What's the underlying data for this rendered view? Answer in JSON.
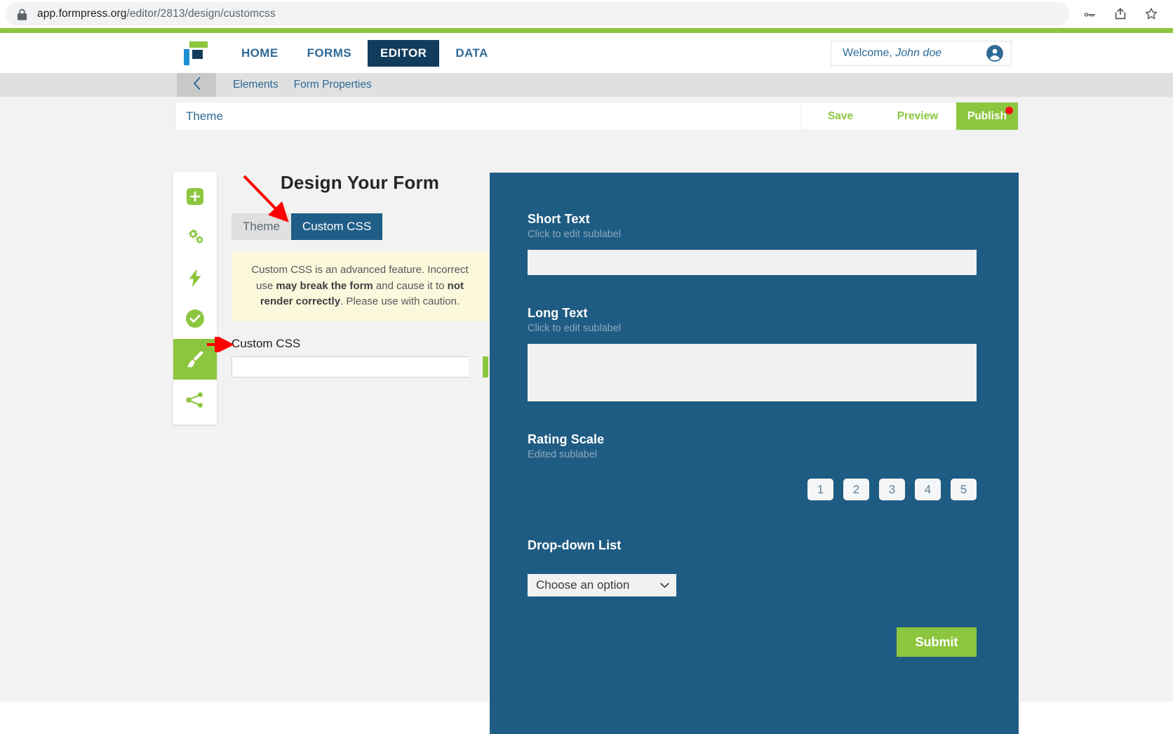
{
  "browser": {
    "url_secure_prefix": "app.formpress.org",
    "url_path": "/editor/2813/design/customcss",
    "lock_icon": "lock-icon",
    "actions": [
      {
        "name": "password-key-icon",
        "label": "key"
      },
      {
        "name": "share-icon",
        "label": "share"
      },
      {
        "name": "bookmark-star-icon",
        "label": "bookmark"
      }
    ]
  },
  "topnav": {
    "logo_name": "formpress-logo",
    "links": [
      {
        "label": "HOME",
        "active": false
      },
      {
        "label": "FORMS",
        "active": false
      },
      {
        "label": "EDITOR",
        "active": true
      },
      {
        "label": "DATA",
        "active": false
      }
    ],
    "welcome_prefix": "Welcome, ",
    "welcome_user": "John doe",
    "avatar_icon": "account-circle-icon"
  },
  "subnav": {
    "back_icon": "chevron-left-icon",
    "links": [
      {
        "label": "Elements"
      },
      {
        "label": "Form Properties"
      }
    ]
  },
  "toolbar": {
    "title_value": "Theme",
    "title_placeholder": "Form title",
    "save_label": "Save",
    "preview_label": "Preview",
    "publish_label": "Publish",
    "publish_badge": "unsaved-changes-dot"
  },
  "rail": {
    "items": [
      {
        "name": "add-element-icon",
        "active": false
      },
      {
        "name": "settings-gears-icon",
        "active": false
      },
      {
        "name": "integrations-bolt-icon",
        "active": false
      },
      {
        "name": "rules-check-icon",
        "active": false
      },
      {
        "name": "design-brush-icon",
        "active": true
      },
      {
        "name": "share-nodes-icon",
        "active": false
      }
    ]
  },
  "design_panel": {
    "title": "Design Your Form",
    "tabs": [
      {
        "label": "Theme",
        "active": false
      },
      {
        "label": "Custom CSS",
        "active": true
      }
    ],
    "warning": {
      "part1": "Custom CSS is an advanced feature. Incorrect use ",
      "bold1": "may break the form",
      "part2": " and cause it to ",
      "bold2": "not render correctly",
      "part3": ". Please use with caution."
    },
    "css_field_label": "Custom CSS",
    "css_field_value": "",
    "css_field_placeholder": ""
  },
  "form_preview": {
    "background_color": "#1f5c83",
    "accent_color": "#8cc63f",
    "fields": [
      {
        "name": "short-text",
        "label": "Short Text",
        "sublabel": "Click to edit sublabel",
        "type": "text",
        "value": ""
      },
      {
        "name": "long-text",
        "label": "Long Text",
        "sublabel": "Click to edit sublabel",
        "type": "textarea",
        "value": ""
      },
      {
        "name": "rating-scale",
        "label": "Rating Scale",
        "sublabel": "Edited sublabel",
        "type": "rating",
        "options": [
          "1",
          "2",
          "3",
          "4",
          "5"
        ]
      },
      {
        "name": "dropdown-list",
        "label": "Drop-down List",
        "sublabel": "",
        "type": "select",
        "selected": "Choose an option"
      }
    ],
    "submit_label": "Submit"
  },
  "annotations": {
    "arrow_color": "#ff0000",
    "arrow_to_custom_css_tab": "points to Custom CSS tab",
    "arrow_to_css_input": "points to Custom CSS input field"
  }
}
